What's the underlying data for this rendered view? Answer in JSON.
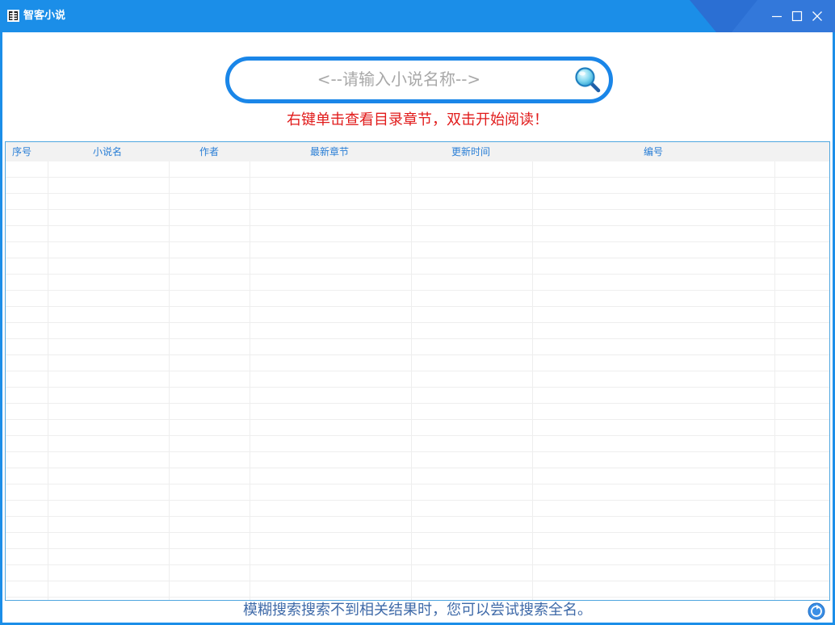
{
  "window": {
    "title": "智客小说",
    "icon": "book-icon",
    "controls": [
      "minimize-icon",
      "maximize-icon",
      "close-icon"
    ],
    "colors": {
      "titlebar": "#1b8ee8",
      "accent": "#1a86e8"
    }
  },
  "search": {
    "placeholder": "<--请输入小说名称-->",
    "value": "",
    "button_icon": "search-icon"
  },
  "hint": {
    "text": "右键单击查看目录章节，双击开始阅读！",
    "color": "#e11b1b"
  },
  "table": {
    "columns": [
      "序号",
      "小说名",
      "作者",
      "最新章节",
      "更新时间",
      "编号"
    ],
    "rows": []
  },
  "footer": {
    "text": "模糊搜索搜索不到相关结果时，您可以尝试搜索全名。",
    "icon": "refresh-icon"
  }
}
